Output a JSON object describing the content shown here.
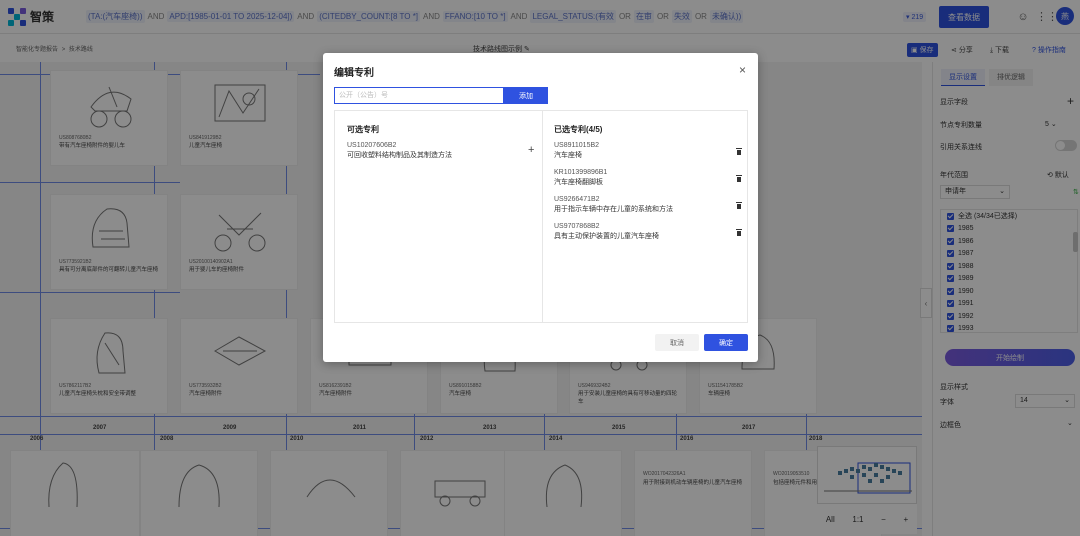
{
  "app": {
    "name": "智策",
    "query_parts": [
      {
        "type": "chip",
        "text": "(TA:(汽车座椅))"
      },
      {
        "type": "kw",
        "text": "AND"
      },
      {
        "type": "chip",
        "text": "APD:[1985-01-01 TO 2025-12-04])"
      },
      {
        "type": "kw",
        "text": "AND"
      },
      {
        "type": "chip",
        "text": "(CITEDBY_COUNT:[8 TO *]"
      },
      {
        "type": "kw",
        "text": "AND"
      },
      {
        "type": "chip",
        "text": "FFANO:[10 TO *]"
      },
      {
        "type": "kw",
        "text": "AND"
      },
      {
        "type": "chip",
        "text": "LEGAL_STATUS:(有效"
      },
      {
        "type": "kw",
        "text": "OR"
      },
      {
        "type": "chip",
        "text": "在审"
      },
      {
        "type": "kw",
        "text": "OR"
      },
      {
        "type": "chip",
        "text": "失效"
      },
      {
        "type": "kw",
        "text": "OR"
      },
      {
        "type": "chip",
        "text": "未确认))"
      }
    ],
    "count_badge": "219",
    "view_data_label": "查看数据",
    "avatar_text": "燕"
  },
  "subbar": {
    "breadcrumb_1": "智能化专题报告",
    "breadcrumb_sep": ">",
    "breadcrumb_2": "技术路线",
    "doc_title": "技术路线图示例",
    "save": "保存",
    "share": "分享",
    "download": "下载",
    "guide": "操作指南"
  },
  "canvas": {
    "cards": [
      {
        "pn": "US8087680B2",
        "title": "带有汽车座椅附件的婴儿车"
      },
      {
        "pn": "US8419129B2",
        "title": "儿童汽车座椅"
      },
      {
        "pn": "US7735921B2",
        "title": "具有可分离底部件的可翻转儿童汽车座椅"
      },
      {
        "pn": "US20100140902A1",
        "title": "用于婴儿车的座椅附件"
      },
      {
        "pn": "US7862117B2",
        "title": "儿童汽车座椅头枕和安全带调整"
      },
      {
        "pn": "US7735932B2",
        "title": "汽车座椅附件"
      },
      {
        "pn": "US8162391B2",
        "title": "汽车座椅附件"
      },
      {
        "pn": "US8910158B2",
        "title": "汽车座椅"
      },
      {
        "pn": "US9469324B2",
        "title": "用于安装儿童座椅的具有可移动量的四轮车"
      },
      {
        "pn": "US11541785B2",
        "title": "车辆座椅"
      },
      {
        "pn": "WO2017042326A1",
        "title": "用于附接到机动车辆座椅的儿童汽车座椅"
      },
      {
        "pn": "WO2019053510",
        "title": "包括座椅元件和用于座椅的基座的儿童"
      }
    ],
    "years_top": [
      "2007",
      "2009",
      "2011",
      "2013",
      "2015",
      "2017"
    ],
    "years_bottom": [
      "2006",
      "2008",
      "2010",
      "2012",
      "2014",
      "2016",
      "2018"
    ],
    "minimap_all": "All",
    "minimap_ratio": "1:1",
    "minimap_minus": "−",
    "minimap_plus": "+"
  },
  "panel": {
    "tab_display": "显示设置",
    "tab_sort": "排优逻辑",
    "display_fields": "显示字段",
    "node_count_label": "节点专利数量",
    "node_count_value": "5",
    "cite_line_label": "引用关系连线",
    "year_range_label": "年代范围",
    "reset_label": "默认",
    "year_type": "申请年",
    "select_all": "全选 (34/34已选择)",
    "years": [
      "1985",
      "1986",
      "1987",
      "1988",
      "1989",
      "1990",
      "1991",
      "1992",
      "1993"
    ],
    "draw_button": "开始绘制",
    "display_style": "显示样式",
    "font_label": "字体",
    "font_value": "14",
    "border_color": "边框色"
  },
  "modal": {
    "title": "编辑专利",
    "input_placeholder": "公开（公告）号",
    "add_button": "添加",
    "available_title": "可选专利",
    "available": [
      {
        "pn": "US10207606B2",
        "title": "可回收塑料结构制品及其制造方法"
      }
    ],
    "selected_title": "已选专利(4/5)",
    "selected": [
      {
        "pn": "US8911015B2",
        "title": "汽车座椅"
      },
      {
        "pn": "KR101399896B1",
        "title": "汽车座椅翻脚板"
      },
      {
        "pn": "US9266471B2",
        "title": "用于指示车辆中存在儿童的系统和方法"
      },
      {
        "pn": "US9707868B2",
        "title": "具有主动保护装置的儿童汽车座椅"
      }
    ],
    "cancel": "取消",
    "confirm": "确定"
  },
  "colors": {
    "primary": "#2f52e0",
    "line": "#6f8ae8",
    "overlay": "rgba(0,0,0,0.45)"
  }
}
